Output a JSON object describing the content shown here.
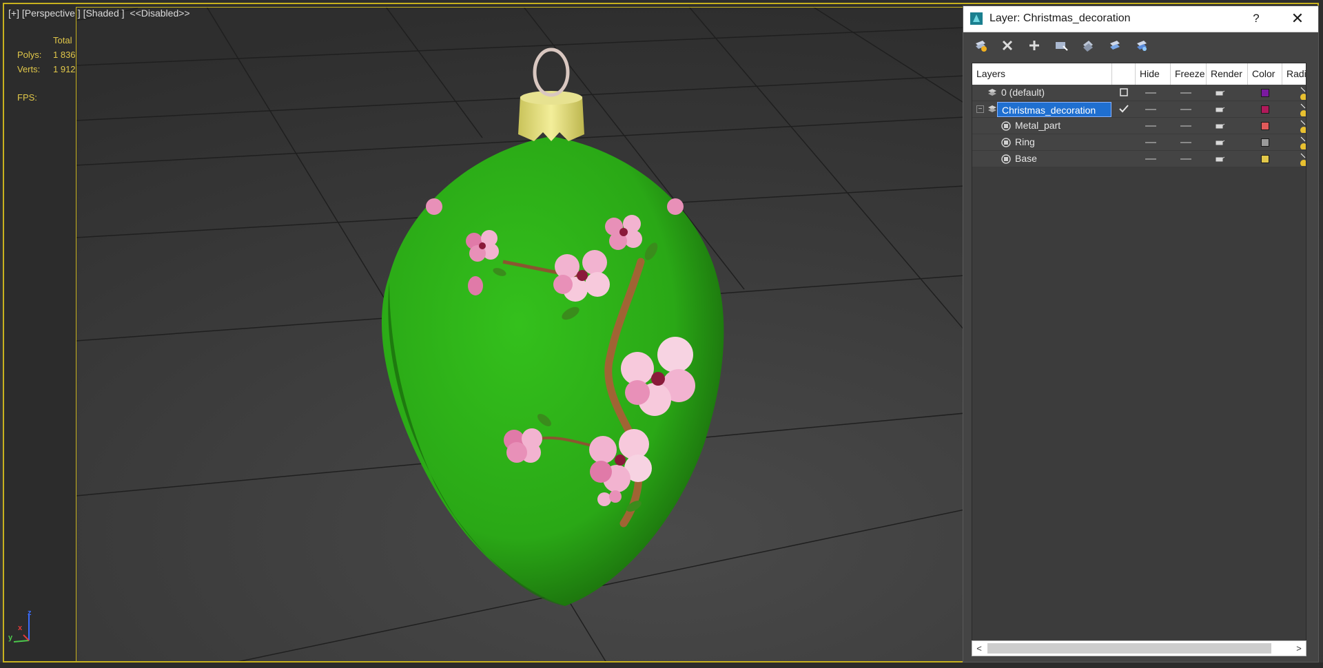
{
  "viewport": {
    "label_plus": "[+]",
    "label_view": "[Perspective ]",
    "label_shading": "[Shaded ]",
    "label_status": "<<Disabled>>",
    "stats": {
      "total_label": "Total",
      "polys_label": "Polys:",
      "polys_value": "1 836",
      "verts_label": "Verts:",
      "verts_value": "1 912",
      "fps_label": "FPS:"
    },
    "axis": {
      "z": "z",
      "x": "x",
      "y": "y"
    },
    "colors": {
      "stats": "#e2c84a",
      "frame": "#c8b21e",
      "grid": "#1e1e1e",
      "ornament_green": "#2fb41a",
      "cap": "#e3dd7c"
    }
  },
  "dialog": {
    "title": "Layer: Christmas_decoration",
    "help": "?",
    "close": "✕",
    "toolbar": [
      {
        "icon": "create-new-layer-icon"
      },
      {
        "icon": "delete-layer-icon"
      },
      {
        "icon": "add-to-layer-icon"
      },
      {
        "icon": "select-objects-icon"
      },
      {
        "icon": "highlight-layer-icon"
      },
      {
        "icon": "hide-all-layers-icon"
      },
      {
        "icon": "freeze-all-layers-icon"
      }
    ],
    "columns": {
      "layers": "Layers",
      "hide": "Hide",
      "freeze": "Freeze",
      "render": "Render",
      "color": "Color",
      "radiosity": "Radio"
    },
    "rows": [
      {
        "name": "0 (default)",
        "type": "layer",
        "active": "box",
        "color": "#7a1aa0"
      },
      {
        "name": "Christmas_decoration",
        "type": "layer",
        "active": "check",
        "color": "#b01a5a",
        "selected": true,
        "expanded": true
      },
      {
        "name": "Metal_part",
        "type": "object",
        "color": "#e05a5a"
      },
      {
        "name": "Ring",
        "type": "object",
        "color": "#9a9a9a"
      },
      {
        "name": "Base",
        "type": "object",
        "color": "#e2c84a"
      }
    ],
    "scroll": {
      "left": "<",
      "right": ">"
    }
  }
}
